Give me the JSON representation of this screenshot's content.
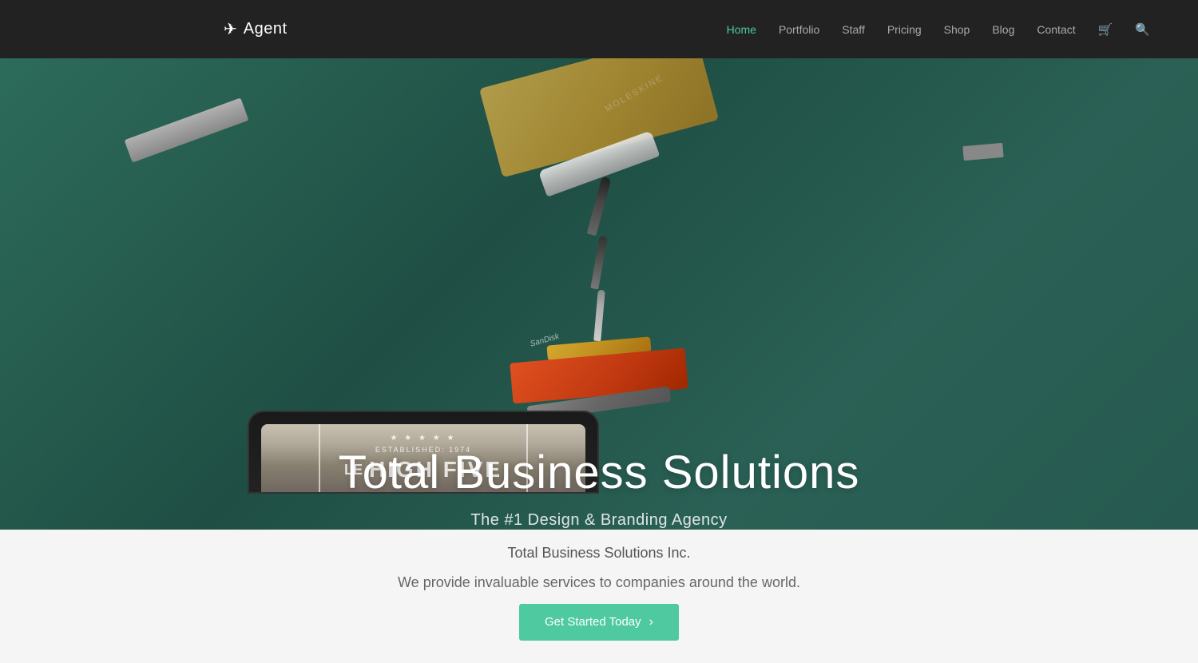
{
  "brand": {
    "name": "Agent",
    "icon": "✈"
  },
  "nav": {
    "links": [
      {
        "label": "Home",
        "active": true
      },
      {
        "label": "Portfolio",
        "active": false
      },
      {
        "label": "Staff",
        "active": false
      },
      {
        "label": "Pricing",
        "active": false
      },
      {
        "label": "Shop",
        "active": false
      },
      {
        "label": "Blog",
        "active": false
      },
      {
        "label": "Contact",
        "active": false
      }
    ]
  },
  "hero": {
    "title": "Total Business Solutions",
    "subtitle": "The #1 Design & Branding Agency"
  },
  "tablet": {
    "stars": "★ ★ ★ ★ ★",
    "established": "ESTABLISHED: 1974",
    "brand_line": "LE",
    "brand_name": "HIGH FIVE"
  },
  "below": {
    "title": "Total Business Solutions Inc.",
    "subtitle": "We provide invaluable services to companies around the world.",
    "cta_label": "Get Started Today",
    "cta_arrow": "›"
  },
  "notebook_label": "MOLESKINE",
  "usb2_label": "SanDisk"
}
